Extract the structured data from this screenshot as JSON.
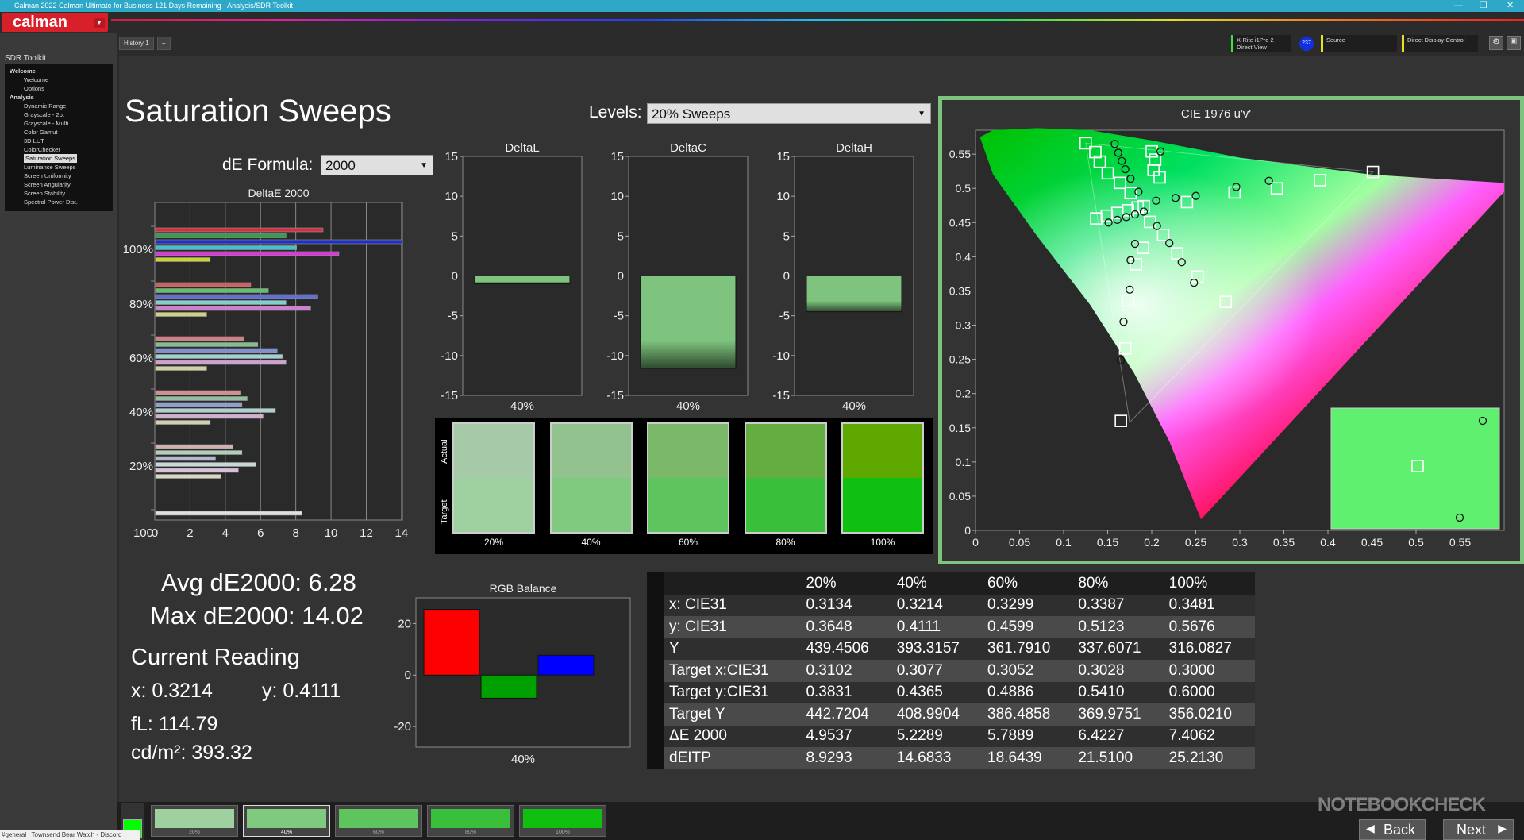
{
  "window": {
    "title": "Calman 2022 Calman Ultimate for Business 121 Days Remaining  - Analysis/SDR Toolkit"
  },
  "logo": {
    "text": "calman"
  },
  "sidebar": {
    "header": "SDR Toolkit",
    "tree": [
      {
        "label": "Welcome",
        "level": 0
      },
      {
        "label": "Welcome",
        "level": 1
      },
      {
        "label": "Options",
        "level": 1
      },
      {
        "label": "Analysis",
        "level": 0
      },
      {
        "label": "Dynamic Range",
        "level": 1
      },
      {
        "label": "Grayscale - 2pt",
        "level": 1
      },
      {
        "label": "Grayscale - Multi",
        "level": 1
      },
      {
        "label": "Color Gamut",
        "level": 1
      },
      {
        "label": "3D LUT",
        "level": 1
      },
      {
        "label": "ColorChecker",
        "level": 1
      },
      {
        "label": "Saturation Sweeps",
        "level": 1,
        "selected": true
      },
      {
        "label": "Luminance Sweeps",
        "level": 1
      },
      {
        "label": "Screen Uniformity",
        "level": 1
      },
      {
        "label": "Screen Angularity",
        "level": 1
      },
      {
        "label": "Screen Stability",
        "level": 1
      },
      {
        "label": "Spectral Power Dist.",
        "level": 1
      }
    ]
  },
  "tabs": {
    "history": "History 1"
  },
  "devices": {
    "meter_line1": "X-Rite i1Pro 2",
    "meter_line2": "Direct View",
    "meter_badge": "237",
    "source": "Source",
    "display": "Direct Display Control"
  },
  "page": {
    "title": "Saturation Sweeps",
    "levels_label": "Levels:",
    "levels_value": "20% Sweeps",
    "de_formula_label": "dE Formula:",
    "de_formula_value": "2000"
  },
  "summary": {
    "avg": "Avg dE2000: 6.28",
    "max": "Max dE2000: 14.02",
    "current_reading": "Current Reading",
    "x": "x: 0.3214",
    "y": "y: 0.4111",
    "fl": "fL: 114.79",
    "cdm2": "cd/m²: 393.32"
  },
  "chart_data": [
    {
      "type": "bar",
      "title": "DeltaE 2000",
      "orientation": "horizontal",
      "categories": [
        "100%",
        "80%",
        "60%",
        "40%",
        "20%",
        "100"
      ],
      "xlim": [
        0,
        15
      ],
      "xticks": [
        0,
        2,
        4,
        6,
        8,
        10,
        12,
        14
      ],
      "groups": [
        {
          "label": "100%",
          "colors": [
            "#d03040",
            "#30a050",
            "#2030c0",
            "#40c0d0",
            "#d040d0",
            "#d0d030"
          ],
          "values": [
            9.5,
            7.4,
            14.0,
            8.0,
            10.4,
            3.1
          ]
        },
        {
          "label": "80%",
          "colors": [
            "#d06060",
            "#60c070",
            "#6070d0",
            "#80d0d0",
            "#d080d0",
            "#d0d080"
          ],
          "values": [
            5.4,
            6.4,
            9.2,
            7.4,
            8.8,
            2.9
          ]
        },
        {
          "label": "60%",
          "colors": [
            "#d08080",
            "#80c090",
            "#8090d0",
            "#a0d0d0",
            "#d0a0d0",
            "#d0d0a0"
          ],
          "values": [
            5.0,
            5.8,
            6.9,
            7.2,
            7.4,
            2.9
          ]
        },
        {
          "label": "40%",
          "colors": [
            "#d09090",
            "#90c0a0",
            "#90a0d0",
            "#b0d0d0",
            "#d0b0d0",
            "#d0d0b0"
          ],
          "values": [
            4.8,
            5.2,
            4.9,
            6.8,
            6.1,
            3.1
          ]
        },
        {
          "label": "20%",
          "colors": [
            "#d0b0b0",
            "#b0d0b8",
            "#b0b8d8",
            "#c8d8d8",
            "#d8c0d8",
            "#d8d8c0"
          ],
          "values": [
            4.4,
            4.9,
            3.4,
            5.7,
            4.7,
            3.7
          ]
        },
        {
          "label": "100",
          "colors": [
            "#e0e0e0"
          ],
          "values": [
            8.3
          ]
        }
      ]
    },
    {
      "type": "bar",
      "title": "DeltaL",
      "categories": [
        "40%"
      ],
      "values": [
        -1.0
      ],
      "ylim": [
        -15,
        15
      ],
      "yticks": [
        15,
        10,
        5,
        0,
        -5,
        -10,
        -15
      ]
    },
    {
      "type": "bar",
      "title": "DeltaC",
      "categories": [
        "40%"
      ],
      "values": [
        -11.6
      ],
      "ylim": [
        -15,
        15
      ],
      "yticks": [
        15,
        10,
        5,
        0,
        -5,
        -10,
        -15
      ]
    },
    {
      "type": "bar",
      "title": "DeltaH",
      "categories": [
        "40%"
      ],
      "values": [
        -4.5
      ],
      "ylim": [
        -15,
        15
      ],
      "yticks": [
        15,
        10,
        5,
        0,
        -5,
        -10,
        -15
      ]
    },
    {
      "type": "bar",
      "title": "RGB Balance",
      "categories": [
        "R",
        "G",
        "B"
      ],
      "xlabel": "40%",
      "values": [
        25.5,
        -9.0,
        7.7
      ],
      "colors": [
        "#ff0000",
        "#00a000",
        "#0000ff"
      ],
      "ylim": [
        -28,
        30
      ],
      "yticks": [
        20,
        0,
        -20
      ]
    },
    {
      "type": "scatter",
      "title": "CIE 1976 u'v'",
      "xlim": [
        0,
        0.6
      ],
      "ylim": [
        0,
        0.6
      ],
      "xticks": [
        "0",
        "0.05",
        "0.1",
        "0.15",
        "0.2",
        "0.25",
        "0.3",
        "0.35",
        "0.4",
        "0.45",
        "0.5",
        "0.55"
      ],
      "yticks": [
        "0",
        "0.05",
        "0.1",
        "0.15",
        "0.2",
        "0.25",
        "0.3",
        "0.35",
        "0.4",
        "0.45",
        "0.5",
        "0.55"
      ],
      "series": [
        {
          "marker": "square",
          "points": [
            [
              0.125,
              0.566
            ],
            [
              0.136,
              0.553
            ],
            [
              0.141,
              0.539
            ],
            [
              0.15,
              0.522
            ],
            [
              0.164,
              0.508
            ],
            [
              0.176,
              0.493
            ],
            [
              0.191,
              0.474
            ],
            [
              0.2,
              0.554
            ],
            [
              0.204,
              0.542
            ],
            [
              0.202,
              0.527
            ],
            [
              0.209,
              0.516
            ],
            [
              0.137,
              0.456
            ],
            [
              0.149,
              0.46
            ],
            [
              0.161,
              0.464
            ],
            [
              0.173,
              0.468
            ],
            [
              0.184,
              0.472
            ],
            [
              0.198,
              0.451
            ],
            [
              0.213,
              0.432
            ],
            [
              0.229,
              0.405
            ],
            [
              0.252,
              0.371
            ],
            [
              0.284,
              0.334
            ],
            [
              0.182,
              0.389
            ],
            [
              0.19,
              0.413
            ],
            [
              0.173,
              0.336
            ],
            [
              0.17,
              0.266
            ],
            [
              0.165,
              0.16
            ],
            [
              0.24,
              0.48
            ],
            [
              0.294,
              0.494
            ],
            [
              0.342,
              0.5
            ],
            [
              0.391,
              0.512
            ],
            [
              0.451,
              0.524
            ]
          ]
        },
        {
          "marker": "circle",
          "points": [
            [
              0.158,
              0.565
            ],
            [
              0.162,
              0.552
            ],
            [
              0.166,
              0.54
            ],
            [
              0.17,
              0.528
            ],
            [
              0.176,
              0.514
            ],
            [
              0.185,
              0.495
            ],
            [
              0.151,
              0.45
            ],
            [
              0.161,
              0.454
            ],
            [
              0.171,
              0.458
            ],
            [
              0.181,
              0.462
            ],
            [
              0.191,
              0.466
            ],
            [
              0.206,
              0.445
            ],
            [
              0.22,
              0.42
            ],
            [
              0.234,
              0.392
            ],
            [
              0.248,
              0.362
            ],
            [
              0.181,
              0.419
            ],
            [
              0.176,
              0.395
            ],
            [
              0.175,
              0.352
            ],
            [
              0.168,
              0.305
            ],
            [
              0.165,
              0.249
            ],
            [
              0.205,
              0.482
            ],
            [
              0.227,
              0.486
            ],
            [
              0.25,
              0.489
            ],
            [
              0.296,
              0.502
            ],
            [
              0.333,
              0.511
            ],
            [
              0.21,
              0.554
            ]
          ]
        }
      ]
    }
  ],
  "swatches": {
    "actual_label": "Actual",
    "target_label": "Target",
    "items": [
      {
        "label": "20%",
        "actual": "#a6c9a8",
        "target": "#9fd09f"
      },
      {
        "label": "40%",
        "actual": "#92c38f",
        "target": "#7fca7f"
      },
      {
        "label": "60%",
        "actual": "#7cb86a",
        "target": "#5ec45e"
      },
      {
        "label": "80%",
        "actual": "#64ad40",
        "target": "#3abf3a"
      },
      {
        "label": "100%",
        "actual": "#5ea800",
        "target": "#10c010"
      }
    ]
  },
  "table": {
    "headers": [
      "",
      "20%",
      "40%",
      "60%",
      "80%",
      "100%"
    ],
    "rows": [
      [
        "x: CIE31",
        "0.3134",
        "0.3214",
        "0.3299",
        "0.3387",
        "0.3481"
      ],
      [
        "y: CIE31",
        "0.3648",
        "0.4111",
        "0.4599",
        "0.5123",
        "0.5676"
      ],
      [
        "Y",
        "439.4506",
        "393.3157",
        "361.7910",
        "337.6071",
        "316.0827"
      ],
      [
        "Target x:CIE31",
        "0.3102",
        "0.3077",
        "0.3052",
        "0.3028",
        "0.3000"
      ],
      [
        "Target y:CIE31",
        "0.3831",
        "0.4365",
        "0.4886",
        "0.5410",
        "0.6000"
      ],
      [
        "Target Y",
        "442.7204",
        "408.9904",
        "386.4858",
        "369.9751",
        "356.0210"
      ],
      [
        "ΔE 2000",
        "4.9537",
        "5.2289",
        "5.7889",
        "6.4227",
        "7.4062"
      ],
      [
        "dEITP",
        "8.9293",
        "14.6833",
        "18.6439",
        "21.5100",
        "25.2130"
      ]
    ]
  },
  "footer": {
    "swatches": [
      {
        "label": "20%",
        "color": "#9fd09f"
      },
      {
        "label": "40%",
        "color": "#7fca7f"
      },
      {
        "label": "60%",
        "color": "#5ec45e"
      },
      {
        "label": "80%",
        "color": "#3abf3a"
      },
      {
        "label": "100%",
        "color": "#10c010"
      }
    ],
    "back": "Back",
    "next": "Next"
  },
  "watermark": "NOTEBOOKCHECK",
  "statusbar": "#general | Townsend Bear Watch - Discord",
  "colors": {
    "accent": "#2ea8c8",
    "brand": "#d8202a",
    "bar_fill": "#7ec47e",
    "cie_frame": "#7ec47e"
  }
}
